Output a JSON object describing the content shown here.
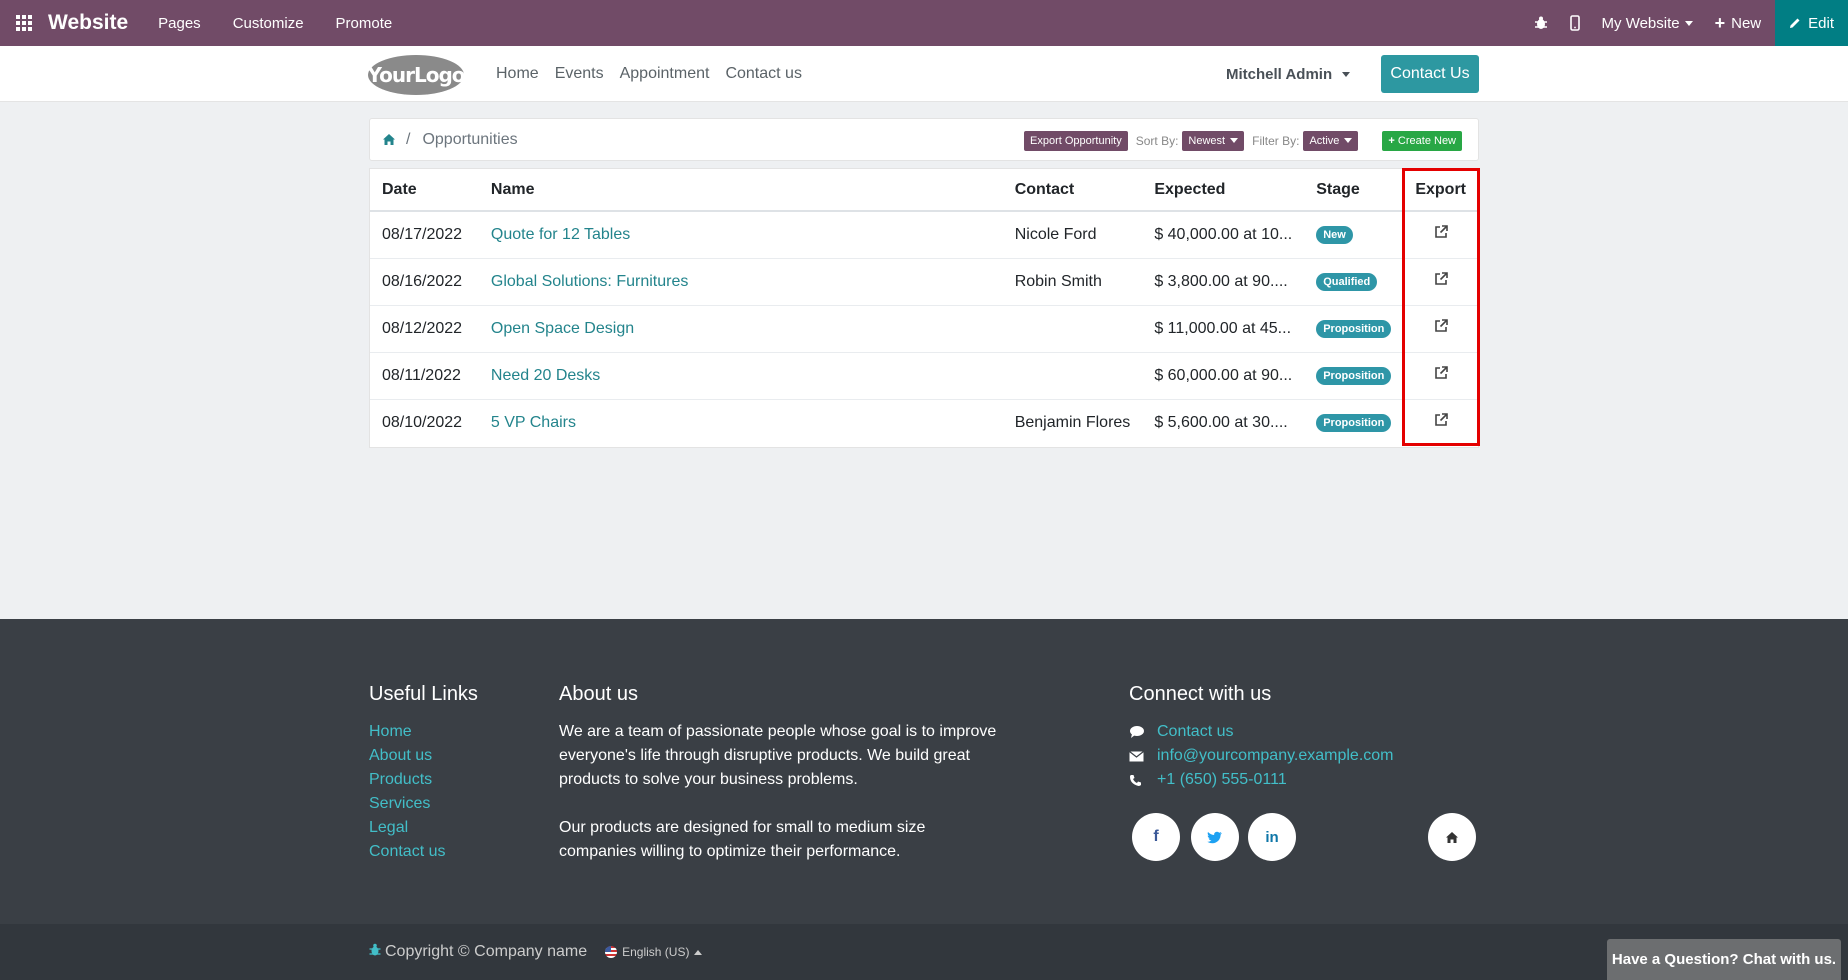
{
  "admin_bar": {
    "brand": "Website",
    "menus": [
      "Pages",
      "Customize",
      "Promote"
    ],
    "my_website": "My Website",
    "new_label": "New",
    "edit_label": "Edit"
  },
  "site_header": {
    "logo_text": "YourLogo",
    "nav": [
      "Home",
      "Events",
      "Appointment",
      "Contact us"
    ],
    "user": "Mitchell Admin",
    "contact_btn": "Contact Us"
  },
  "breadcrumb": {
    "separator": "/",
    "current": "Opportunities"
  },
  "toolbar": {
    "export_btn": "Export Opportunity",
    "sort_label": "Sort By:",
    "sort_value": "Newest",
    "filter_label": "Filter By:",
    "filter_value": "Active",
    "create_btn": "Create New"
  },
  "table": {
    "headers": [
      "Date",
      "Name",
      "Contact",
      "Expected",
      "Stage",
      "Export"
    ],
    "rows": [
      {
        "date": "08/17/2022",
        "name": "Quote for 12 Tables",
        "contact": "Nicole Ford",
        "expected": "$ 40,000.00 at 10...",
        "stage": "New"
      },
      {
        "date": "08/16/2022",
        "name": "Global Solutions: Furnitures",
        "contact": "Robin Smith",
        "expected": "$ 3,800.00 at 90....",
        "stage": "Qualified"
      },
      {
        "date": "08/12/2022",
        "name": "Open Space Design",
        "contact": "",
        "expected": "$ 11,000.00 at 45...",
        "stage": "Proposition"
      },
      {
        "date": "08/11/2022",
        "name": "Need 20 Desks",
        "contact": "",
        "expected": "$ 60,000.00 at 90...",
        "stage": "Proposition"
      },
      {
        "date": "08/10/2022",
        "name": "5 VP Chairs",
        "contact": "Benjamin Flores",
        "expected": "$ 5,600.00 at 30....",
        "stage": "Proposition"
      }
    ]
  },
  "footer": {
    "useful_links_title": "Useful Links",
    "useful_links": [
      "Home",
      "About us",
      "Products",
      "Services",
      "Legal",
      "Contact us"
    ],
    "about_title": "About us",
    "about_p1": "We are a team of passionate people whose goal is to improve everyone's life through disruptive products. We build great products to solve your business problems.",
    "about_p2": "Our products are designed for small to medium size companies willing to optimize their performance.",
    "connect_title": "Connect with us",
    "contact_link": "Contact us",
    "email": "info@yourcompany.example.com",
    "phone": "+1 (650) 555-0111",
    "social": {
      "facebook": "f",
      "linkedin": "in"
    }
  },
  "bottom": {
    "copyright": "Copyright © Company name",
    "language": "English (US)"
  },
  "chat": "Have a Question? Chat with us.",
  "colors": {
    "brand": "#714b67",
    "teal": "#2d98a1",
    "highlight": "#e40000",
    "footer_bg": "#3a3f45"
  }
}
